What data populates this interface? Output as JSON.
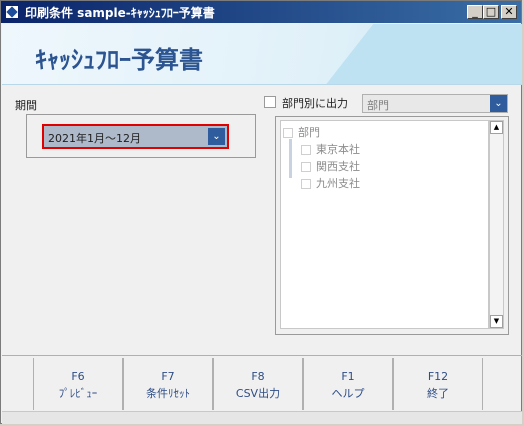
{
  "window": {
    "title": "印刷条件 sample-ｷｬｯｼｭﾌﾛｰ予算書",
    "controls": {
      "minimize": "_",
      "maximize": "□",
      "close": "✕"
    }
  },
  "header": {
    "report_title": "ｷｬｯｼｭﾌﾛｰ予算書"
  },
  "period": {
    "label": "期間",
    "selected": "2021年1月～12月"
  },
  "department": {
    "output_by_dept_label": "部門別に出力",
    "checked": false,
    "select_value": "部門",
    "tree": {
      "root": "部門",
      "items": [
        "東京本社",
        "関西支社",
        "九州支社"
      ]
    }
  },
  "function_keys": [
    {
      "key": "F6",
      "label": "ﾌﾟﾚﾋﾞｭｰ"
    },
    {
      "key": "F7",
      "label": "条件ﾘｾｯﾄ"
    },
    {
      "key": "F8",
      "label": "CSV出力"
    },
    {
      "key": "F1",
      "label": "ヘルプ"
    },
    {
      "key": "F12",
      "label": "終了"
    }
  ],
  "icons": {
    "select_toggle": "chevron-down-icon",
    "app": "app-icon",
    "scroll_up": "scroll-up-arrow-icon",
    "scroll_down": "scroll-down-arrow-icon"
  },
  "colors": {
    "title_bar": "#0a246a",
    "accent": "#2c5490",
    "highlight_border": "#e00000",
    "select_button": "#2e5c9c"
  }
}
